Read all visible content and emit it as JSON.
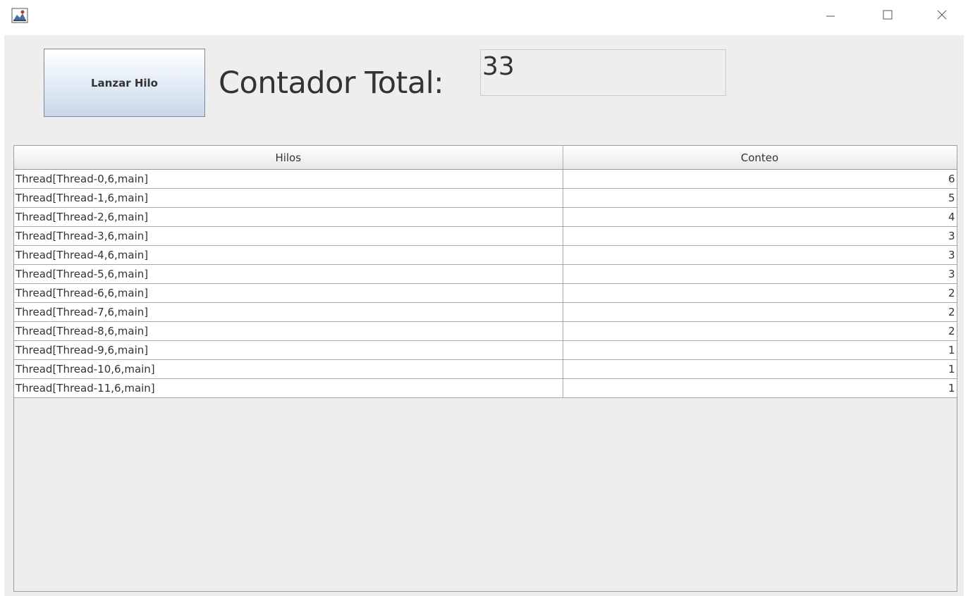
{
  "window": {
    "icon": "java-app-icon",
    "controls": [
      "minimize-icon",
      "maximize-icon",
      "close-icon"
    ]
  },
  "toolbar": {
    "launch_label": "Lanzar Hilo",
    "counter_label": "Contador Total:",
    "counter_value": "33"
  },
  "table": {
    "columns": [
      "Hilos",
      "Conteo"
    ],
    "rows": [
      {
        "thread": "Thread[Thread-0,6,main]",
        "count": "6"
      },
      {
        "thread": "Thread[Thread-1,6,main]",
        "count": "5"
      },
      {
        "thread": "Thread[Thread-2,6,main]",
        "count": "4"
      },
      {
        "thread": "Thread[Thread-3,6,main]",
        "count": "3"
      },
      {
        "thread": "Thread[Thread-4,6,main]",
        "count": "3"
      },
      {
        "thread": "Thread[Thread-5,6,main]",
        "count": "3"
      },
      {
        "thread": "Thread[Thread-6,6,main]",
        "count": "2"
      },
      {
        "thread": "Thread[Thread-7,6,main]",
        "count": "2"
      },
      {
        "thread": "Thread[Thread-8,6,main]",
        "count": "2"
      },
      {
        "thread": "Thread[Thread-9,6,main]",
        "count": "1"
      },
      {
        "thread": "Thread[Thread-10,6,main]",
        "count": "1"
      },
      {
        "thread": "Thread[Thread-11,6,main]",
        "count": "1"
      }
    ]
  }
}
